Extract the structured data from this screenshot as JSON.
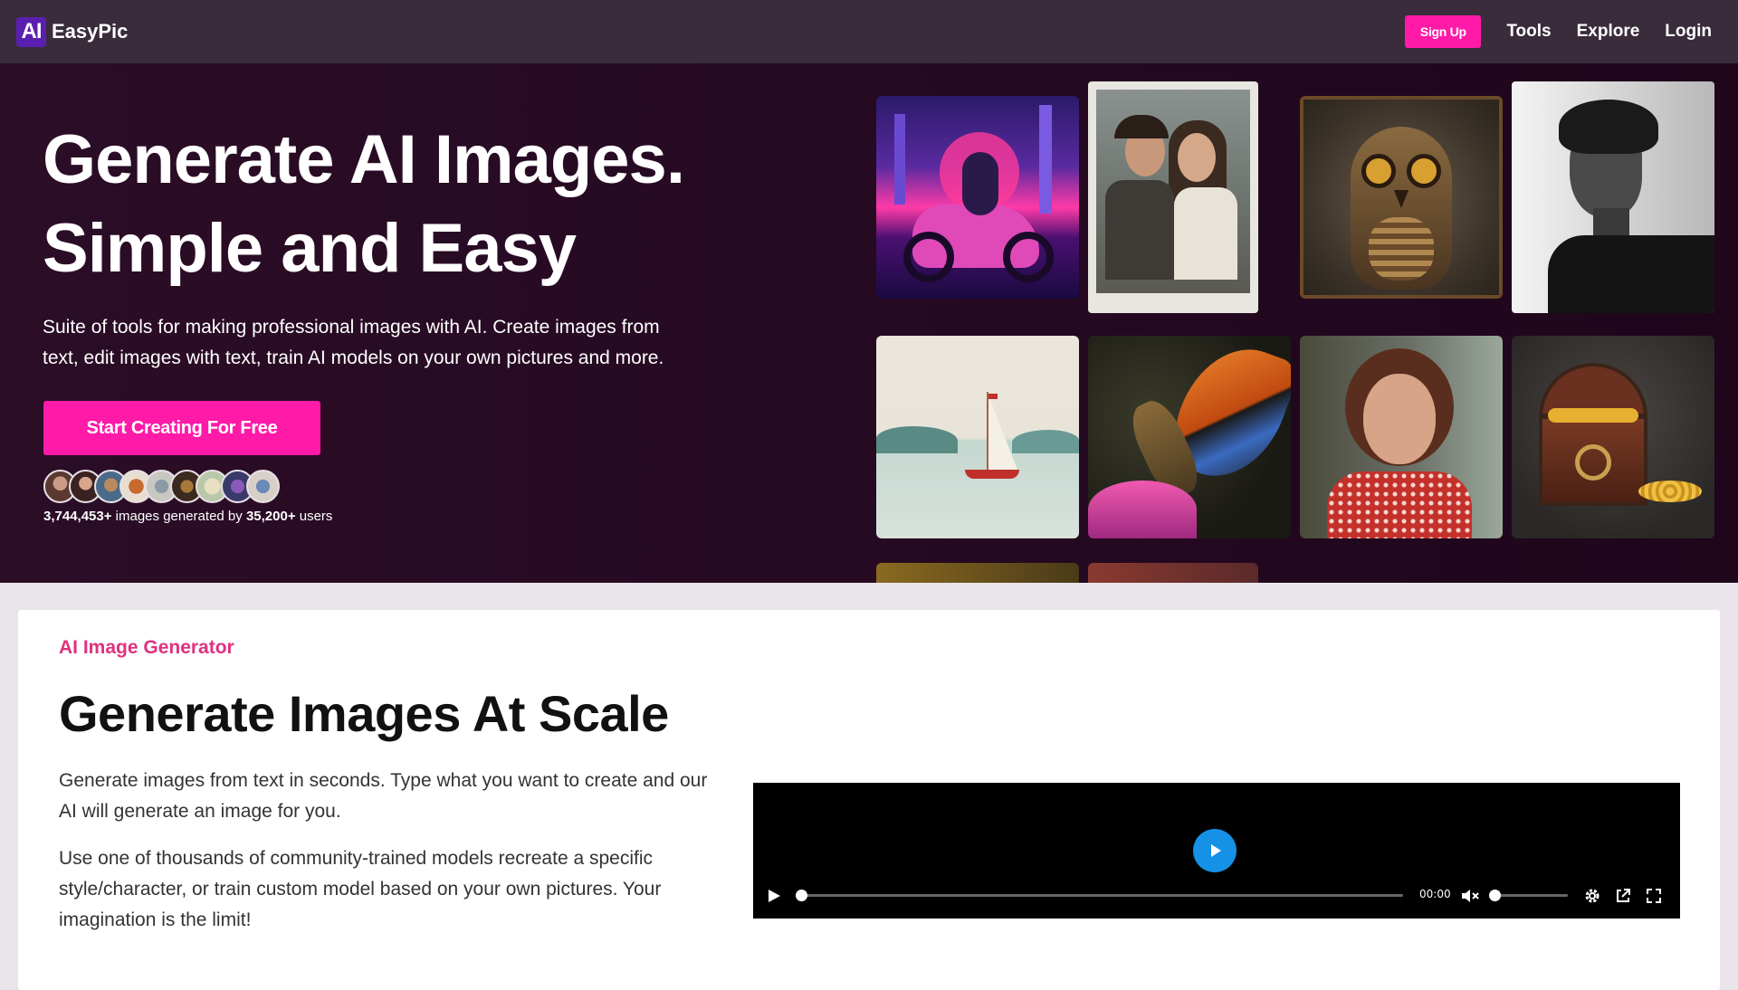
{
  "nav": {
    "logo_mark": "AI",
    "brand": "EasyPic",
    "signup": "Sign Up",
    "links": [
      "Tools",
      "Explore",
      "Login"
    ]
  },
  "hero": {
    "title_line1": "Generate AI Images.",
    "title_line2": "Simple and Easy",
    "subtitle_line1": "Suite of tools for making professional images with AI. Create images from",
    "subtitle_line2": "text, edit images with text, train AI models on your own pictures and more.",
    "cta": "Start Creating For Free",
    "stats": {
      "images": "3,744,453+",
      "mid": " images generated by ",
      "users": "35,200+",
      "tail": " users"
    }
  },
  "gallery": [
    {
      "name": "neon-motorcycle-image"
    },
    {
      "name": "couple-portrait-image"
    },
    {
      "name": "mechanical-owl-image"
    },
    {
      "name": "bw-profile-portrait-image"
    },
    {
      "name": "sailboat-image"
    },
    {
      "name": "butterfly-image"
    },
    {
      "name": "woman-portrait-image"
    },
    {
      "name": "treasure-chest-image"
    }
  ],
  "section": {
    "eyebrow": "AI Image Generator",
    "title": "Generate Images At Scale",
    "para1": "Generate images from text in seconds. Type what you want to create and our AI will generate an image for you.",
    "para2": "Use one of thousands of community-trained models recreate a specific style/character, or train custom model based on your own pictures. Your imagination is the limit!"
  },
  "video": {
    "time": "00:00",
    "progress": 0,
    "volume": 0
  },
  "colors": {
    "accent": "#ff1aa8",
    "nav_bg": "#3a2c3b",
    "hero_bg": "#260a22",
    "eyebrow": "#e0317f",
    "play": "#1592e6"
  }
}
